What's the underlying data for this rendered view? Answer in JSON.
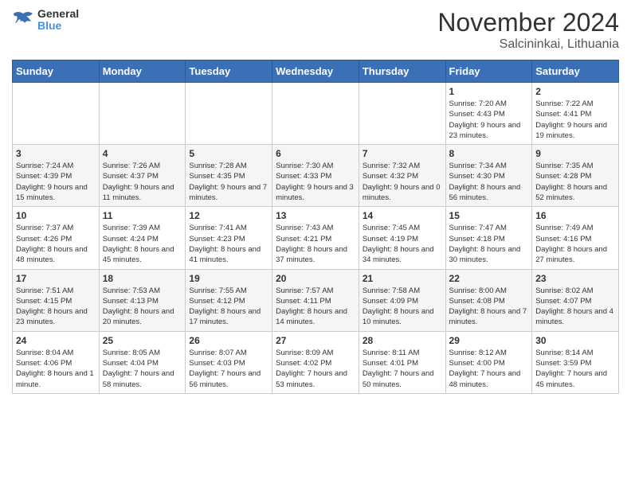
{
  "header": {
    "logo_line1": "General",
    "logo_line2": "Blue",
    "month": "November 2024",
    "location": "Salcininkai, Lithuania"
  },
  "weekdays": [
    "Sunday",
    "Monday",
    "Tuesday",
    "Wednesday",
    "Thursday",
    "Friday",
    "Saturday"
  ],
  "weeks": [
    [
      {
        "day": "",
        "info": ""
      },
      {
        "day": "",
        "info": ""
      },
      {
        "day": "",
        "info": ""
      },
      {
        "day": "",
        "info": ""
      },
      {
        "day": "",
        "info": ""
      },
      {
        "day": "1",
        "info": "Sunrise: 7:20 AM\nSunset: 4:43 PM\nDaylight: 9 hours and 23 minutes."
      },
      {
        "day": "2",
        "info": "Sunrise: 7:22 AM\nSunset: 4:41 PM\nDaylight: 9 hours and 19 minutes."
      }
    ],
    [
      {
        "day": "3",
        "info": "Sunrise: 7:24 AM\nSunset: 4:39 PM\nDaylight: 9 hours and 15 minutes."
      },
      {
        "day": "4",
        "info": "Sunrise: 7:26 AM\nSunset: 4:37 PM\nDaylight: 9 hours and 11 minutes."
      },
      {
        "day": "5",
        "info": "Sunrise: 7:28 AM\nSunset: 4:35 PM\nDaylight: 9 hours and 7 minutes."
      },
      {
        "day": "6",
        "info": "Sunrise: 7:30 AM\nSunset: 4:33 PM\nDaylight: 9 hours and 3 minutes."
      },
      {
        "day": "7",
        "info": "Sunrise: 7:32 AM\nSunset: 4:32 PM\nDaylight: 9 hours and 0 minutes."
      },
      {
        "day": "8",
        "info": "Sunrise: 7:34 AM\nSunset: 4:30 PM\nDaylight: 8 hours and 56 minutes."
      },
      {
        "day": "9",
        "info": "Sunrise: 7:35 AM\nSunset: 4:28 PM\nDaylight: 8 hours and 52 minutes."
      }
    ],
    [
      {
        "day": "10",
        "info": "Sunrise: 7:37 AM\nSunset: 4:26 PM\nDaylight: 8 hours and 48 minutes."
      },
      {
        "day": "11",
        "info": "Sunrise: 7:39 AM\nSunset: 4:24 PM\nDaylight: 8 hours and 45 minutes."
      },
      {
        "day": "12",
        "info": "Sunrise: 7:41 AM\nSunset: 4:23 PM\nDaylight: 8 hours and 41 minutes."
      },
      {
        "day": "13",
        "info": "Sunrise: 7:43 AM\nSunset: 4:21 PM\nDaylight: 8 hours and 37 minutes."
      },
      {
        "day": "14",
        "info": "Sunrise: 7:45 AM\nSunset: 4:19 PM\nDaylight: 8 hours and 34 minutes."
      },
      {
        "day": "15",
        "info": "Sunrise: 7:47 AM\nSunset: 4:18 PM\nDaylight: 8 hours and 30 minutes."
      },
      {
        "day": "16",
        "info": "Sunrise: 7:49 AM\nSunset: 4:16 PM\nDaylight: 8 hours and 27 minutes."
      }
    ],
    [
      {
        "day": "17",
        "info": "Sunrise: 7:51 AM\nSunset: 4:15 PM\nDaylight: 8 hours and 23 minutes."
      },
      {
        "day": "18",
        "info": "Sunrise: 7:53 AM\nSunset: 4:13 PM\nDaylight: 8 hours and 20 minutes."
      },
      {
        "day": "19",
        "info": "Sunrise: 7:55 AM\nSunset: 4:12 PM\nDaylight: 8 hours and 17 minutes."
      },
      {
        "day": "20",
        "info": "Sunrise: 7:57 AM\nSunset: 4:11 PM\nDaylight: 8 hours and 14 minutes."
      },
      {
        "day": "21",
        "info": "Sunrise: 7:58 AM\nSunset: 4:09 PM\nDaylight: 8 hours and 10 minutes."
      },
      {
        "day": "22",
        "info": "Sunrise: 8:00 AM\nSunset: 4:08 PM\nDaylight: 8 hours and 7 minutes."
      },
      {
        "day": "23",
        "info": "Sunrise: 8:02 AM\nSunset: 4:07 PM\nDaylight: 8 hours and 4 minutes."
      }
    ],
    [
      {
        "day": "24",
        "info": "Sunrise: 8:04 AM\nSunset: 4:06 PM\nDaylight: 8 hours and 1 minute."
      },
      {
        "day": "25",
        "info": "Sunrise: 8:05 AM\nSunset: 4:04 PM\nDaylight: 7 hours and 58 minutes."
      },
      {
        "day": "26",
        "info": "Sunrise: 8:07 AM\nSunset: 4:03 PM\nDaylight: 7 hours and 56 minutes."
      },
      {
        "day": "27",
        "info": "Sunrise: 8:09 AM\nSunset: 4:02 PM\nDaylight: 7 hours and 53 minutes."
      },
      {
        "day": "28",
        "info": "Sunrise: 8:11 AM\nSunset: 4:01 PM\nDaylight: 7 hours and 50 minutes."
      },
      {
        "day": "29",
        "info": "Sunrise: 8:12 AM\nSunset: 4:00 PM\nDaylight: 7 hours and 48 minutes."
      },
      {
        "day": "30",
        "info": "Sunrise: 8:14 AM\nSunset: 3:59 PM\nDaylight: 7 hours and 45 minutes."
      }
    ]
  ]
}
